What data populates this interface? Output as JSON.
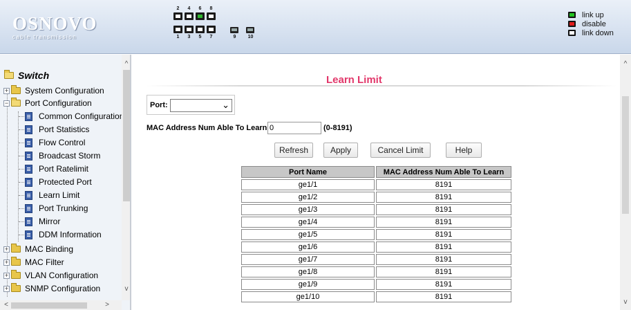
{
  "header": {
    "logo_main": "OSNOVO",
    "logo_sub": "cable transmission",
    "port_numbers_top": [
      "2",
      "4",
      "6",
      "8"
    ],
    "port_numbers_bottom": [
      "1",
      "3",
      "5",
      "7"
    ],
    "sfp_numbers": [
      "9",
      "10"
    ],
    "legend": [
      {
        "label": "link up",
        "color": "#22c322"
      },
      {
        "label": "disable",
        "color": "#e01c1c"
      },
      {
        "label": "link down",
        "color": "#ffffff"
      }
    ]
  },
  "sidebar": {
    "root": "Switch",
    "items": [
      {
        "label": "System Configuration",
        "type": "folder",
        "expander": "+"
      },
      {
        "label": "Port Configuration",
        "type": "folder-open",
        "expander": "-"
      },
      {
        "label": "Common Configuration",
        "type": "page"
      },
      {
        "label": "Port Statistics",
        "type": "page"
      },
      {
        "label": "Flow Control",
        "type": "page"
      },
      {
        "label": "Broadcast Storm",
        "type": "page"
      },
      {
        "label": "Port Ratelimit",
        "type": "page"
      },
      {
        "label": "Protected Port",
        "type": "page"
      },
      {
        "label": "Learn Limit",
        "type": "page"
      },
      {
        "label": "Port Trunking",
        "type": "page"
      },
      {
        "label": "Mirror",
        "type": "page"
      },
      {
        "label": "DDM Information",
        "type": "page"
      },
      {
        "label": "MAC Binding",
        "type": "folder",
        "expander": "+"
      },
      {
        "label": "MAC Filter",
        "type": "folder",
        "expander": "+"
      },
      {
        "label": "VLAN Configuration",
        "type": "folder",
        "expander": "+"
      },
      {
        "label": "SNMP Configuration",
        "type": "folder",
        "expander": "+"
      }
    ]
  },
  "main": {
    "title": "Learn Limit",
    "port_label": "Port:",
    "port_value": "",
    "mac_label": "MAC Address Num Able To Learn:",
    "mac_value": "0",
    "mac_range": "(0-8191)",
    "buttons": {
      "refresh": "Refresh",
      "apply": "Apply",
      "cancel_limit": "Cancel Limit",
      "help": "Help"
    },
    "table": {
      "headers": [
        "Port Name",
        "MAC Address Num Able To Learn"
      ],
      "rows": [
        [
          "ge1/1",
          "8191"
        ],
        [
          "ge1/2",
          "8191"
        ],
        [
          "ge1/3",
          "8191"
        ],
        [
          "ge1/4",
          "8191"
        ],
        [
          "ge1/5",
          "8191"
        ],
        [
          "ge1/6",
          "8191"
        ],
        [
          "ge1/7",
          "8191"
        ],
        [
          "ge1/8",
          "8191"
        ],
        [
          "ge1/9",
          "8191"
        ],
        [
          "ge1/10",
          "8191"
        ]
      ]
    }
  },
  "scroll": {
    "up": "^",
    "down": "v",
    "left": "<",
    "right": ">"
  }
}
